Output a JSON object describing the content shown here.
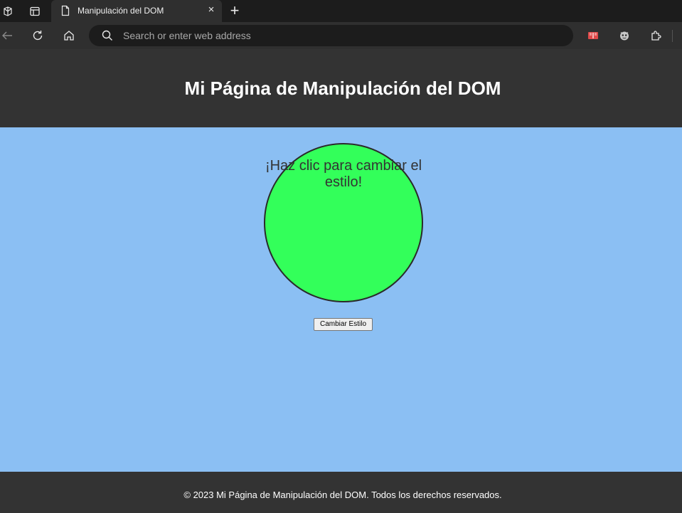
{
  "browser": {
    "tab_title": "Manipulación del DOM",
    "tab_close": "×",
    "new_tab": "+",
    "address_placeholder": "Search or enter web address",
    "icons": [
      "workspaces-icon",
      "tab-actions-icon",
      "page-icon",
      "back-icon",
      "refresh-icon",
      "home-icon",
      "search-icon",
      "immersive-reader-icon",
      "extension-badge-icon",
      "extensions-icon"
    ]
  },
  "page": {
    "header_title": "Mi Página de Manipulación del DOM",
    "circle_text": "¡Haz clic para cambiar el estilo!",
    "button_label": "Cambiar Estilo",
    "footer_text": "© 2023 Mi Página de Manipulación del DOM. Todos los derechos reservados."
  },
  "colors": {
    "page_background": "#8bbff3",
    "header_footer_background": "#333333",
    "circle_fill": "#33ff5a",
    "browser_dark": "#1c1c1c",
    "browser_toolbar": "#2f2f2f"
  }
}
